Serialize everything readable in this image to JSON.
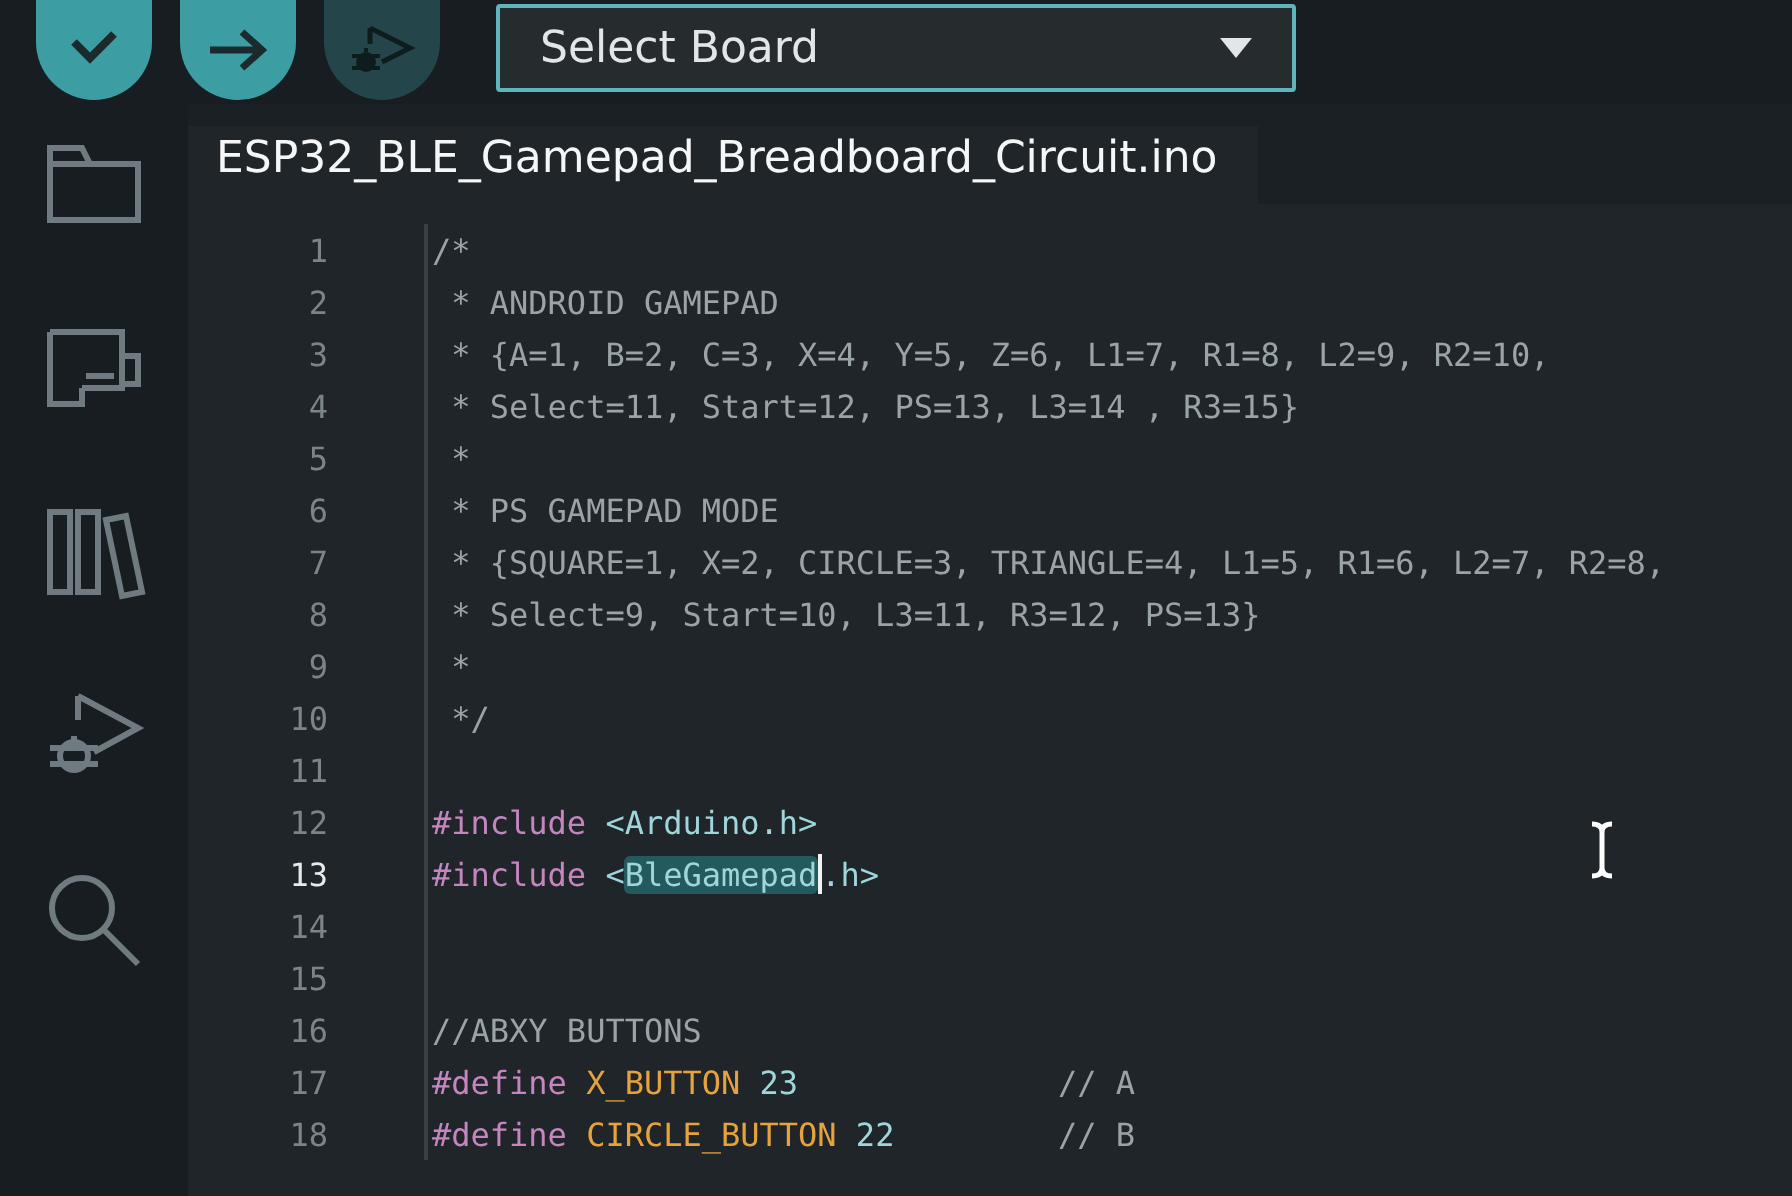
{
  "toolbar": {
    "buttons": [
      {
        "kind": "verify",
        "disabled": false
      },
      {
        "kind": "upload",
        "disabled": false
      },
      {
        "kind": "debug",
        "disabled": true
      }
    ],
    "board_select": {
      "label": "Select Board"
    }
  },
  "sidebar": {
    "items": [
      {
        "kind": "sketchbook"
      },
      {
        "kind": "boards"
      },
      {
        "kind": "library"
      },
      {
        "kind": "debug"
      },
      {
        "kind": "search"
      }
    ]
  },
  "editor": {
    "tab": {
      "title": "ESP32_BLE_Gamepad_Breadboard_Circuit.ino"
    },
    "lines": [
      {
        "number": "1",
        "current": false,
        "tokens": [
          {
            "kind": "comment",
            "text": "/*"
          }
        ]
      },
      {
        "number": "2",
        "current": false,
        "tokens": [
          {
            "kind": "comment",
            "text": " * ANDROID GAMEPAD"
          }
        ]
      },
      {
        "number": "3",
        "current": false,
        "tokens": [
          {
            "kind": "comment",
            "text": " * {A=1, B=2, C=3, X=4, Y=5, Z=6, L1=7, R1=8, L2=9, R2=10,"
          }
        ]
      },
      {
        "number": "4",
        "current": false,
        "tokens": [
          {
            "kind": "comment",
            "text": " * Select=11, Start=12, PS=13, L3=14 , R3=15}"
          }
        ]
      },
      {
        "number": "5",
        "current": false,
        "tokens": [
          {
            "kind": "comment",
            "text": " *"
          }
        ]
      },
      {
        "number": "6",
        "current": false,
        "tokens": [
          {
            "kind": "comment",
            "text": " * PS GAMEPAD MODE"
          }
        ]
      },
      {
        "number": "7",
        "current": false,
        "tokens": [
          {
            "kind": "comment",
            "text": " * {SQUARE=1, X=2, CIRCLE=3, TRIANGLE=4, L1=5, R1=6, L2=7, R2=8,"
          }
        ]
      },
      {
        "number": "8",
        "current": false,
        "tokens": [
          {
            "kind": "comment",
            "text": " * Select=9, Start=10, L3=11, R3=12, PS=13}"
          }
        ]
      },
      {
        "number": "9",
        "current": false,
        "tokens": [
          {
            "kind": "comment",
            "text": " *"
          }
        ]
      },
      {
        "number": "10",
        "current": false,
        "tokens": [
          {
            "kind": "comment",
            "text": " */"
          }
        ]
      },
      {
        "number": "11",
        "current": false
      },
      {
        "number": "12",
        "current": false,
        "tokens": [
          {
            "kind": "keyword",
            "text": "#include"
          },
          {
            "kind": "path",
            "text": " <Arduino.h>"
          }
        ]
      },
      {
        "number": "13",
        "current": true,
        "tokens": [
          {
            "kind": "keyword",
            "text": "#include"
          },
          {
            "kind": "path",
            "text": " <"
          },
          {
            "kind": "selection",
            "text": "BleGamepad"
          },
          {
            "kind": "path",
            "text": ".h>"
          }
        ]
      },
      {
        "number": "14",
        "current": false
      },
      {
        "number": "15",
        "current": false
      },
      {
        "number": "16",
        "current": false,
        "tokens": [
          {
            "kind": "comment",
            "text": "//ABXY BUTTONS"
          }
        ]
      },
      {
        "number": "17",
        "current": false,
        "tokens": [
          {
            "kind": "keyword",
            "text": "#define"
          },
          {
            "kind": "macro",
            "text": " X_BUTTON"
          },
          {
            "kind": "number",
            "text": " 23"
          },
          {
            "kind": "aside",
            "text": "// A"
          }
        ]
      },
      {
        "number": "18",
        "current": false,
        "tokens": [
          {
            "kind": "keyword",
            "text": "#define"
          },
          {
            "kind": "macro",
            "text": " CIRCLE_BUTTON"
          },
          {
            "kind": "number",
            "text": " 22"
          },
          {
            "kind": "aside",
            "text": "// B"
          }
        ]
      }
    ]
  }
}
